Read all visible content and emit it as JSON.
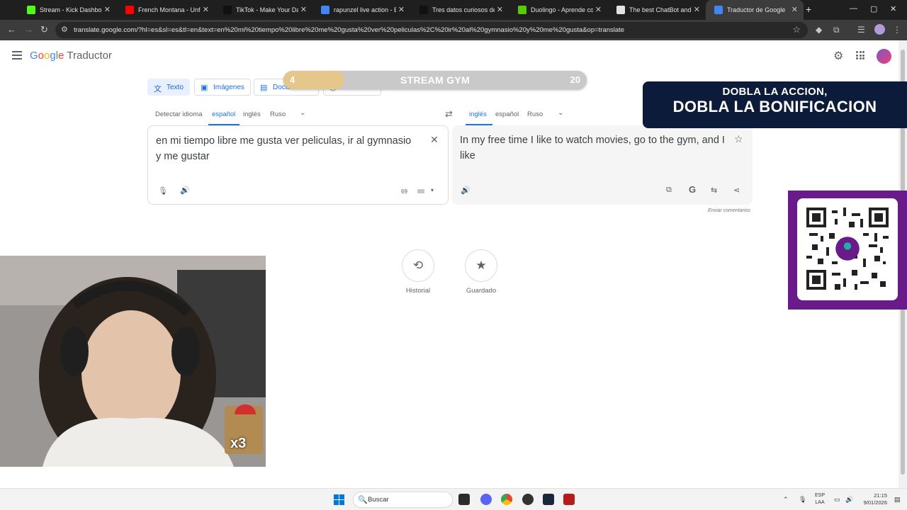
{
  "browser": {
    "tabs": [
      {
        "label": "Stream - Kick Dashboard",
        "favicon_color": "#53fc18"
      },
      {
        "label": "French Montana - Unforgettable",
        "favicon_color": "#ff0000"
      },
      {
        "label": "TikTok - Make Your Day",
        "favicon_color": "#111111"
      },
      {
        "label": "rapunzel live action - Buscar",
        "favicon_color": "#4285f4"
      },
      {
        "label": "Tres datos curiosos de Faraón",
        "favicon_color": "#111111"
      },
      {
        "label": "Duolingo - Aprende con Duo",
        "favicon_color": "#58cc02"
      },
      {
        "label": "The best ChatBot and",
        "favicon_color": "#e3e3e3"
      },
      {
        "label": "Traductor de Google",
        "favicon_color": "#4285f4"
      }
    ],
    "active_tab": 7,
    "url": "translate.google.com/?hl=es&sl=es&tl=en&text=en%20mi%20tiempo%20libre%20me%20gusta%20ver%20peliculas%2C%20ir%20al%20gymnasio%20y%20me%20gusta&op=translate"
  },
  "app": {
    "logo_g": "G",
    "logo_o1": "o",
    "logo_o2": "o",
    "logo_g2": "g",
    "logo_l": "l",
    "logo_e": "e",
    "product": "Traductor"
  },
  "modes": [
    "Texto",
    "Imágenes",
    "Documentos",
    "Sitios web"
  ],
  "source_langs": [
    "Detectar idioma",
    "español",
    "inglés",
    "Ruso"
  ],
  "target_langs": [
    "inglés",
    "español",
    "Ruso"
  ],
  "source": {
    "text": "en mi tiempo libre me gusta ver peliculas, ir al gymnasio y me gustar",
    "char_count": "69"
  },
  "target": {
    "text": "In my free time I like to watch movies, go to the gym, and I like"
  },
  "feedback_label": "Enviar comentarios",
  "history_label": "Historial",
  "saved_label": "Guardado",
  "overlay": {
    "gym_current": "4",
    "gym_title": "STREAM GYM",
    "gym_goal": "20",
    "gym_progress": 0.2,
    "promo_line1": "DOBLA LA ACCION,",
    "promo_line2": "DOBLA LA BONIFICACION",
    "badge_label": "x3"
  },
  "taskbar": {
    "search_placeholder": "Buscar",
    "lang_line1": "ESP",
    "lang_line2": "LAA",
    "time": "21:15",
    "date": "9/01/2026"
  }
}
